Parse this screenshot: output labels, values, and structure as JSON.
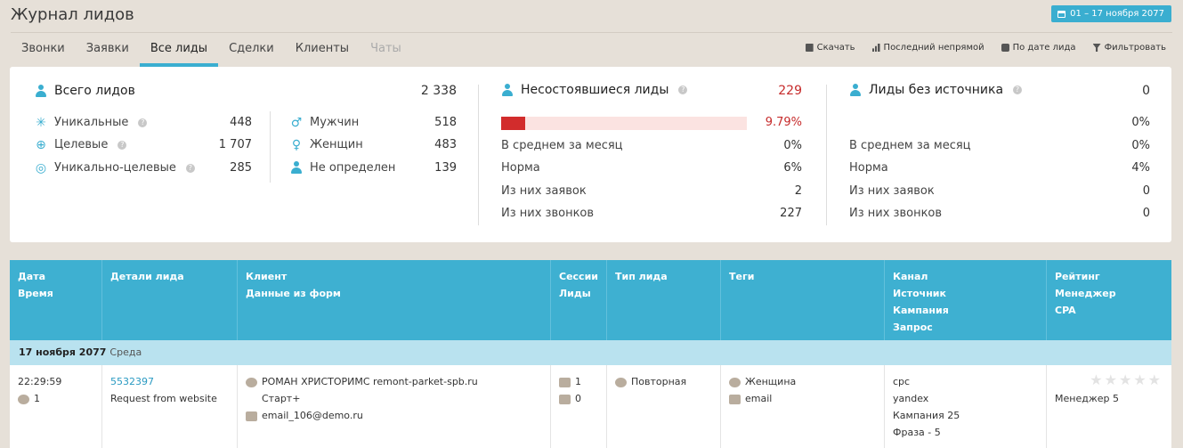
{
  "header": {
    "title": "Журнал лидов",
    "date_range": "01 – 17 ноября 2077"
  },
  "tabs": [
    {
      "label": "Звонки"
    },
    {
      "label": "Заявки"
    },
    {
      "label": "Все лиды"
    },
    {
      "label": "Сделки"
    },
    {
      "label": "Клиенты"
    },
    {
      "label": "Чаты"
    }
  ],
  "active_tab": "Все лиды",
  "actions": {
    "download": "Скачать",
    "last_indirect": "Последний непрямой",
    "by_lead_date": "По дате лида",
    "filter": "Фильтровать"
  },
  "stats": {
    "total": {
      "label": "Всего лидов",
      "value": "2 338"
    },
    "unique": {
      "label": "Уникальные",
      "value": "448"
    },
    "target": {
      "label": "Целевые",
      "value": "1 707"
    },
    "unique_target": {
      "label": "Уникально-целевые",
      "value": "285"
    },
    "male": {
      "label": "Мужчин",
      "value": "518"
    },
    "female": {
      "label": "Женщин",
      "value": "483"
    },
    "undefined": {
      "label": "Не определен",
      "value": "139"
    },
    "failed": {
      "label": "Несостоявшиеся лиды",
      "value": "229",
      "percent": "9.79%",
      "progress": 0.0979,
      "avg_month": {
        "label": "В среднем за месяц",
        "value": "0%"
      },
      "norm": {
        "label": "Норма",
        "value": "6%"
      },
      "requests": {
        "label": "Из них заявок",
        "value": "2"
      },
      "calls": {
        "label": "Из них звонков",
        "value": "227"
      }
    },
    "no_source": {
      "label": "Лиды без источника",
      "value": "0",
      "percent": "0%",
      "avg_month": {
        "label": "В среднем за месяц",
        "value": "0%"
      },
      "norm": {
        "label": "Норма",
        "value": "4%"
      },
      "requests": {
        "label": "Из них заявок",
        "value": "0"
      },
      "calls": {
        "label": "Из них звонков",
        "value": "0"
      }
    }
  },
  "table": {
    "columns": [
      {
        "l1": "Дата",
        "l2": "Время",
        "l3": "",
        "l4": ""
      },
      {
        "l1": "Детали лида",
        "l2": "",
        "l3": "",
        "l4": ""
      },
      {
        "l1": "Клиент",
        "l2": "Данные из форм",
        "l3": "",
        "l4": ""
      },
      {
        "l1": "Сессии",
        "l2": "Лиды",
        "l3": "",
        "l4": ""
      },
      {
        "l1": "Тип лида",
        "l2": "",
        "l3": "",
        "l4": ""
      },
      {
        "l1": "Теги",
        "l2": "",
        "l3": "",
        "l4": ""
      },
      {
        "l1": "Канал",
        "l2": "Источник",
        "l3": "Кампания",
        "l4": "Запрос"
      },
      {
        "l1": "Рейтинг",
        "l2": "Менеджер",
        "l3": "CPA",
        "l4": ""
      }
    ],
    "group": {
      "date": "17 ноября 2077",
      "weekday": "Среда"
    },
    "row": {
      "time": "22:29:59",
      "comments": "1",
      "lead_id": "5532397",
      "lead_detail": "Request from website",
      "client_name": "РОМАН ХРИСТОРИМС remont-parket-spb.ru",
      "client_sub": "Старт+",
      "client_email": "email_106@demo.ru",
      "sessions": "1",
      "leads": "0",
      "lead_type": "Повторная",
      "tag1": "Женщина",
      "tag2": "email",
      "channel": "cpc",
      "source": "yandex",
      "campaign": "Кампания 25",
      "query": "Фраза - 5",
      "stars": "★★★★★",
      "manager": "Менеджер 5"
    }
  }
}
